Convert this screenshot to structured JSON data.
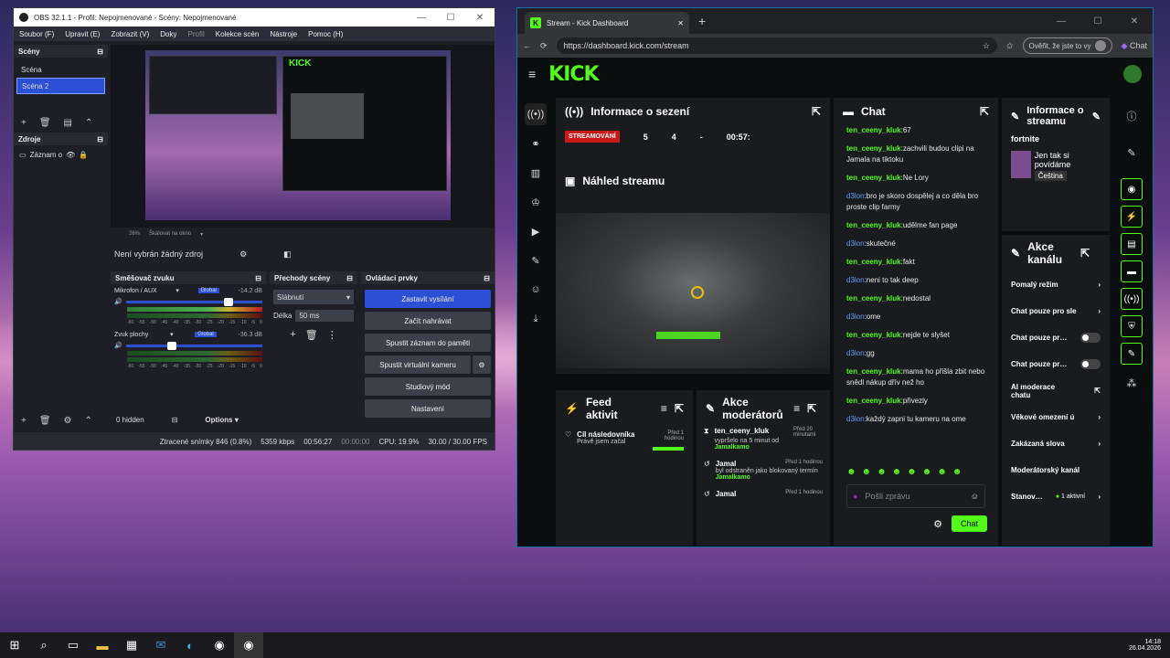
{
  "obs": {
    "title": "OBS 32.1.1 - Profil: Nepojmenované - Scény: Nepojmenované",
    "menu": [
      "Soubor (F)",
      "Upravit (E)",
      "Zobrazit (V)",
      "Doky",
      "Profil",
      "Kolekce scén",
      "Nástroje",
      "Pomoc (H)"
    ],
    "scenes_title": "Scény",
    "scenes": [
      "Scéna",
      "Scéna 2"
    ],
    "sources_title": "Zdroje",
    "source_item": "Záznam o",
    "zoom": "26%",
    "scale_label": "Škálovat na okno",
    "no_source": "Není vybrán žádný zdroj",
    "mixer_title": "Směšovač zvuku",
    "ch1_name": "Mikrofon / AUX",
    "ch1_db": "-14.2 dB",
    "ch2_name": "Zvuk plochy",
    "ch2_db": "-36.3 dB",
    "global_label": "Global",
    "scale_ticks": [
      "-60",
      "-55",
      "-50",
      "-45",
      "-40",
      "-35",
      "-30",
      "-25",
      "-20",
      "-15",
      "-10",
      "-5",
      "0"
    ],
    "transitions_title": "Přechody scény",
    "transition": "Slábnutí",
    "duration_label": "Délka",
    "duration": "50 ms",
    "controls_title": "Ovládací prvky",
    "controls": [
      "Zastavit vysílání",
      "Začít nahrávat",
      "Spustit záznam do paměti",
      "Spustit virtuální kameru",
      "Studiový mód",
      "Nastavení"
    ],
    "hidden": "0 hidden",
    "options": "Options",
    "status": {
      "dropped": "Ztracené snímky 846 (0.8%)",
      "kbps": "5359 kbps",
      "live": "00:56:27",
      "rec": "00:00:00",
      "cpu": "CPU: 19.9%",
      "fps": "30.00 / 30.00 FPS"
    }
  },
  "browser": {
    "tab_title": "Stream - Kick Dashboard",
    "url": "https://dashboard.kick.com/stream",
    "verify": "Ověřit, že jste to vy",
    "chat_btn": "Chat"
  },
  "kick": {
    "logo": "KICK",
    "session_title": "Informace o sezení",
    "live_badge": "STREAMOVÁNÍ",
    "stats": [
      "5",
      "4",
      "-",
      "00:57:"
    ],
    "preview_title": "Náhled streamu",
    "feed_title": "Feed aktivit",
    "feed_item_title": "Cíl následovníka",
    "feed_item_sub": "Právě jsem začal",
    "feed_item_time": "Před 1 hodinou",
    "mod_title": "Akce moderátorů",
    "mod_items": [
      {
        "user": "ten_ceeny_kluk",
        "time": "Před 20 minutami",
        "desc": "vypršelo na 5 minut od",
        "by": "Jamalkamo"
      },
      {
        "user": "Jamal",
        "time": "Před 1 hodinou",
        "desc": "byl odstraněn jako blokovaný termín",
        "by": "Jamalkamo"
      },
      {
        "user": "Jamal",
        "time": "Před 1 hodinou",
        "desc": "",
        "by": ""
      }
    ],
    "chat_title": "Chat",
    "chat": [
      {
        "u": "ten_ceeny_kluk",
        "m": ":67",
        "c": "g"
      },
      {
        "u": "ten_ceeny_kluk",
        "m": ":zachvili budou clipi na Jamala na tiktoku",
        "c": "g"
      },
      {
        "u": "ten_ceeny_kluk",
        "m": ":Ne Lory",
        "c": "g"
      },
      {
        "u": "d3lon",
        "m": ":bro je skoro dospělej a co děla bro proste clip farmy",
        "c": "b"
      },
      {
        "u": "ten_ceeny_kluk",
        "m": ":udělme fan page",
        "c": "g"
      },
      {
        "u": "d3lon",
        "m": ":skutečné",
        "c": "b"
      },
      {
        "u": "ten_ceeny_kluk",
        "m": ":fakt",
        "c": "g"
      },
      {
        "u": "d3lon",
        "m": ":neni to tak deep",
        "c": "b"
      },
      {
        "u": "ten_ceeny_kluk",
        "m": ":nedostal",
        "c": "g"
      },
      {
        "u": "d3lon",
        "m": ":ome",
        "c": "b"
      },
      {
        "u": "ten_ceeny_kluk",
        "m": ":nejde te slyšet",
        "c": "g"
      },
      {
        "u": "d3lon",
        "m": ":gg",
        "c": "b"
      },
      {
        "u": "ten_ceeny_kluk",
        "m": ":mama ho přišla zbit nebo snědl nákup dřív než ho",
        "c": "g"
      },
      {
        "u": "ten_ceeny_kluk",
        "m": ":přivezly",
        "c": "g"
      },
      {
        "u": "d3lon",
        "m": ":každý zapni tu kameru na ome",
        "c": "b"
      }
    ],
    "chat_placeholder": "Pošli zprávu",
    "chat_send": "Chat",
    "info_title": "Informace o streamu",
    "category": "fortnite",
    "stream_title": "Jen tak si povídáme",
    "language": "Čeština",
    "actions_title": "Akce kanálu",
    "actions": [
      "Pomalý režim",
      "Chat pouze pro sle",
      "Chat pouze pr…",
      "Chat pouze pr…",
      "AI moderace chatu",
      "Věkové omezení ú",
      "Zakázaná slova",
      "Moderátorský kanál",
      "Stanov…"
    ],
    "active_label": "1 aktivní"
  },
  "taskbar": {
    "time": "14:18",
    "date": "26.04.2026"
  }
}
